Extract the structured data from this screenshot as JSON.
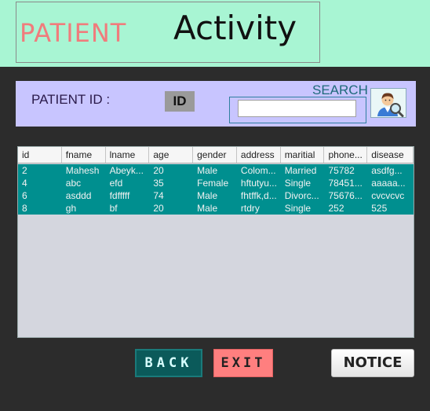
{
  "header": {
    "title_left": "PATIENT",
    "title_right": "Activity"
  },
  "search_bar": {
    "patient_id_label": "PATIENT ID :",
    "id_value": "ID",
    "search_label": "SEARCH",
    "search_value": "",
    "search_icon": "doctor-magnifier-icon"
  },
  "table": {
    "columns": [
      "id",
      "fname",
      "lname",
      "age",
      "gender",
      "address",
      "maritial",
      "phone...",
      "disease"
    ],
    "rows": [
      [
        "2",
        "Mahesh",
        "Abeyk...",
        "20",
        "Male",
        "Colom...",
        "Married",
        "75782",
        "asdfg..."
      ],
      [
        "4",
        "abc",
        "efd",
        "35",
        "Female",
        "hftutyu...",
        "Single",
        "78451...",
        "aaaaa..."
      ],
      [
        "6",
        "asddd",
        "fdfffff",
        "74",
        "Male",
        "fhtffk,d...",
        "Divorc...",
        "75676...",
        "cvcvcvc"
      ],
      [
        "8",
        "gh",
        "bf",
        "20",
        "Male",
        "rtdry",
        "Single",
        "252",
        "525"
      ]
    ]
  },
  "buttons": {
    "back": "BACK",
    "exit": "EXIT",
    "notice": "NOTICE"
  },
  "colors": {
    "header_bg": "#a8f5d3",
    "panel_bg": "#2c2c2c",
    "search_bar_bg": "#c8c5ff",
    "row_bg": "#008f8f",
    "back_bg": "#0b5a5a",
    "exit_bg": "#ff7f7f"
  }
}
